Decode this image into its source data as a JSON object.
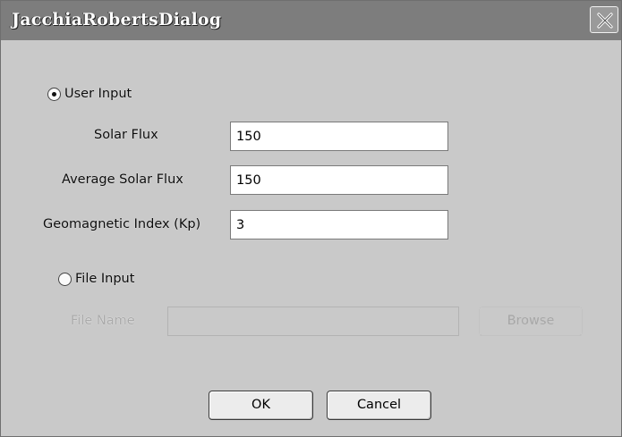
{
  "window": {
    "title": "JacchiaRobertsDialog"
  },
  "user_input": {
    "label": "User Input",
    "selected": true,
    "solar_flux": {
      "label": "Solar Flux",
      "value": "150"
    },
    "avg_solar_flux": {
      "label": "Average Solar Flux",
      "value": "150"
    },
    "geomagnetic_index": {
      "label": "Geomagnetic Index (Kp)",
      "value": "3"
    }
  },
  "file_input": {
    "label": "File Input",
    "selected": false,
    "file_name_label": "File Name",
    "file_name_value": "",
    "browse_label": "Browse"
  },
  "buttons": {
    "ok": "OK",
    "cancel": "Cancel"
  },
  "icons": {
    "close": "close-icon"
  }
}
